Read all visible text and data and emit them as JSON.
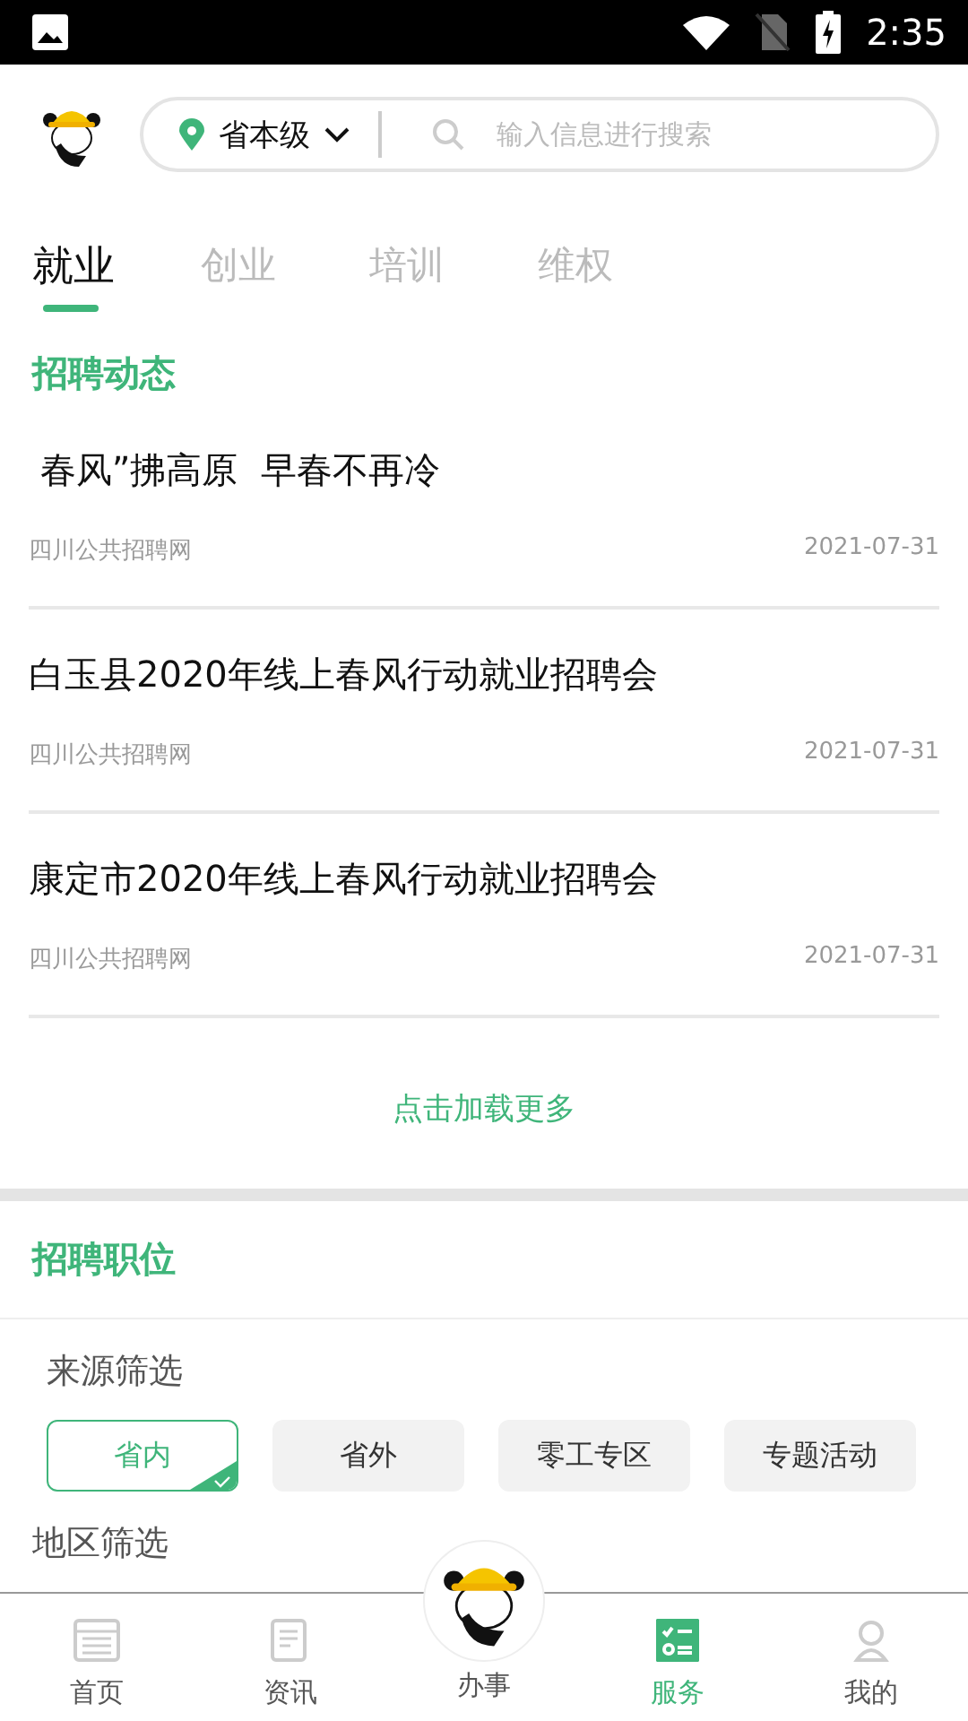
{
  "status_bar": {
    "time": "2:35"
  },
  "header": {
    "region": "省本级",
    "search": {
      "placeholder": "输入信息进行搜索"
    }
  },
  "tabs": [
    {
      "label": "就业",
      "selected": true
    },
    {
      "label": "创业",
      "selected": false
    },
    {
      "label": "培训",
      "selected": false
    },
    {
      "label": "维权",
      "selected": false
    }
  ],
  "news": {
    "title": "招聘动态",
    "items": [
      {
        "title": " 春风”拂高原  早春不再冷",
        "source": "四川公共招聘网",
        "date": "2021-07-31"
      },
      {
        "title": "白玉县2020年线上春风行动就业招聘会",
        "source": "四川公共招聘网",
        "date": "2021-07-31"
      },
      {
        "title": "康定市2020年线上春风行动就业招聘会",
        "source": "四川公共招聘网",
        "date": "2021-07-31"
      }
    ],
    "load_more": "点击加载更多"
  },
  "jobs": {
    "title": "招聘职位",
    "source_filter": {
      "label": "来源筛选",
      "options": [
        {
          "label": "省内",
          "selected": true
        },
        {
          "label": "省外",
          "selected": false
        },
        {
          "label": "零工专区",
          "selected": false
        },
        {
          "label": "专题活动",
          "selected": false
        }
      ]
    },
    "region_filter": {
      "label": "地区筛选"
    }
  },
  "bottom_nav": [
    {
      "kind": "home",
      "label": "首页",
      "selected": false
    },
    {
      "kind": "news",
      "label": "资讯",
      "selected": false
    },
    {
      "kind": "center",
      "label": "办事",
      "selected": false
    },
    {
      "kind": "service",
      "label": "服务",
      "selected": true
    },
    {
      "kind": "profile",
      "label": "我的",
      "selected": false
    }
  ]
}
